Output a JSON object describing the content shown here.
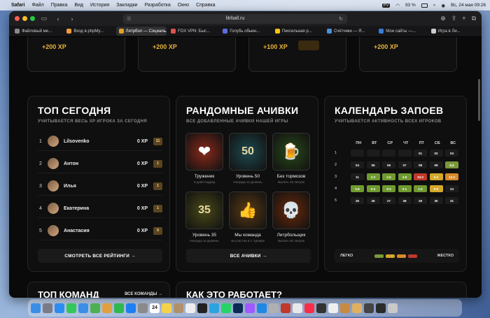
{
  "menubar": {
    "app": "Safari",
    "items": [
      "Файл",
      "Правка",
      "Вид",
      "История",
      "Закладки",
      "Разработка",
      "Окно",
      "Справка"
    ],
    "battery": "93 %",
    "datetime": "Вс, 24 мая  09:26",
    "kb_badge": "PV"
  },
  "browser": {
    "url": "litrball.ru",
    "tabs": [
      {
        "label": "Файловый ме...",
        "color": "#888888"
      },
      {
        "label": "Вход в phpMy...",
        "color": "#f29a3a"
      },
      {
        "label": "Литрбол — Социаль...",
        "color": "#e0a020",
        "active": true
      },
      {
        "label": "FOX VPN: Быс...",
        "color": "#d9534f"
      },
      {
        "label": "Голубь обыкн...",
        "color": "#5a6ee0"
      },
      {
        "label": "Пиксельная р...",
        "color": "#f1c40f"
      },
      {
        "label": "Счётчики — Я...",
        "color": "#4a90d9"
      },
      {
        "label": "Мои сайты —...",
        "color": "#3a7bd5"
      },
      {
        "label": "Игра в Ли...",
        "color": "#cccccc"
      }
    ]
  },
  "xp_strip": [
    "+200 XP",
    "+200 XP",
    "+100 XP",
    "+200 XP"
  ],
  "top_today": {
    "title": "ТОП СЕГОДНЯ",
    "subtitle": "УЧИТЫВАЕТСЯ ВЕСЬ XP ИГРОКА ЗА СЕГОДНЯ",
    "rows": [
      {
        "num": "1",
        "name": "Lilsovenko",
        "xp": "0 XP",
        "badge": "11"
      },
      {
        "num": "2",
        "name": "Антон",
        "xp": "0 XP",
        "badge": "1"
      },
      {
        "num": "3",
        "name": "Илья",
        "xp": "0 XP",
        "badge": "1"
      },
      {
        "num": "4",
        "name": "Екатерина",
        "xp": "0 XP",
        "badge": "1"
      },
      {
        "num": "5",
        "name": "Анастасия",
        "xp": "0 XP",
        "badge": "9"
      }
    ],
    "button": "СМОТРЕТЬ ВСЕ РЕЙТИНГИ →"
  },
  "achievements": {
    "title": "РАНДОМНЫЕ АЧИВКИ",
    "subtitle": "ВСЕ ДОБАВЛЕННЫЕ АЧИВКИ НАШЕЙ ИГРЫ",
    "items": [
      {
        "title": "Труженик",
        "desc": "5 дней подряд",
        "icon": "heart-icon",
        "glyph": "❤",
        "color": "#8a2a1a"
      },
      {
        "title": "Уровень 50",
        "desc": "Награда за уровень",
        "icon": "level-50-icon",
        "glyph": "50",
        "color": "#1e4a50"
      },
      {
        "title": "Без тормозов",
        "desc": "Выпить 25 литров",
        "icon": "beer-mug-icon",
        "glyph": "🍺",
        "color": "#2a4a1a"
      },
      {
        "title": "Уровень 35",
        "desc": "Награда за уровень",
        "icon": "level-35-icon",
        "glyph": "35",
        "color": "#4a4a18"
      },
      {
        "title": "Мы команда",
        "desc": "За участие в 1 турнире",
        "icon": "thumbs-up-icon",
        "glyph": "👍",
        "color": "#5a3a14"
      },
      {
        "title": "Литрбольщик",
        "desc": "Выпить 50 литров",
        "icon": "flaming-skull-icon",
        "glyph": "💀",
        "color": "#6a2a0a"
      }
    ],
    "button": "ВСЕ АЧИВКИ →"
  },
  "calendar": {
    "title": "КАЛЕНДАРЬ ЗАПОЕВ",
    "subtitle": "УЧИТЫВАЕТСЯ АКТИВНОСТЬ ВСЕХ ИГРОКОВ",
    "days": [
      "ПН",
      "ВТ",
      "СР",
      "ЧТ",
      "ПТ",
      "СБ",
      "ВС"
    ],
    "weeks": [
      {
        "label": "1",
        "cells": [
          {
            "v": "",
            "c": ""
          },
          {
            "v": "",
            "c": ""
          },
          {
            "v": "",
            "c": ""
          },
          {
            "v": "",
            "c": ""
          },
          {
            "v": "01",
            "c": ""
          },
          {
            "v": "02",
            "c": ""
          },
          {
            "v": "03",
            "c": ""
          }
        ]
      },
      {
        "label": "2",
        "cells": [
          {
            "v": "04",
            "c": ""
          },
          {
            "v": "05",
            "c": ""
          },
          {
            "v": "06",
            "c": ""
          },
          {
            "v": "07",
            "c": ""
          },
          {
            "v": "08",
            "c": ""
          },
          {
            "v": "09",
            "c": ""
          },
          {
            "v": "6.6",
            "c": "#7a9a3a"
          }
        ]
      },
      {
        "label": "3",
        "cells": [
          {
            "v": "11",
            "c": ""
          },
          {
            "v": "2.2",
            "c": "#6f9a30"
          },
          {
            "v": "2.5",
            "c": "#6f9a30"
          },
          {
            "v": "2.8",
            "c": "#6f9a30"
          },
          {
            "v": "33.0",
            "c": "#c0392b"
          },
          {
            "v": "5.4",
            "c": "#d4a82a"
          },
          {
            "v": "12.0",
            "c": "#d88a2a"
          }
        ]
      },
      {
        "label": "4",
        "cells": [
          {
            "v": "0.9",
            "c": "#6f9a30"
          },
          {
            "v": "0.3",
            "c": "#6f9a30"
          },
          {
            "v": "0.3",
            "c": "#6f9a30"
          },
          {
            "v": "0.1",
            "c": "#6f9a30"
          },
          {
            "v": "1.0",
            "c": "#6f9a30"
          },
          {
            "v": "0.9",
            "c": "#d4a82a"
          },
          {
            "v": "24",
            "c": ""
          }
        ]
      },
      {
        "label": "5",
        "cells": [
          {
            "v": "25",
            "c": ""
          },
          {
            "v": "26",
            "c": ""
          },
          {
            "v": "27",
            "c": ""
          },
          {
            "v": "28",
            "c": ""
          },
          {
            "v": "29",
            "c": ""
          },
          {
            "v": "30",
            "c": ""
          },
          {
            "v": "31",
            "c": ""
          }
        ]
      }
    ],
    "legend_easy": "ЛЕГКО",
    "legend_hard": "ЖЕСТКО",
    "legend_colors": [
      "#7a9a3a",
      "#d4a82a",
      "#d88a2a",
      "#c0392b"
    ]
  },
  "bottom": {
    "teams_title": "ТОП КОМАНД",
    "teams_link": "ВСЕ КОМАНДЫ →",
    "how_title": "КАК ЭТО РАБОТАЕТ?"
  },
  "dock": {
    "calendar_day": "24",
    "apps": [
      {
        "name": "finder-icon",
        "color": "#3a8ee6"
      },
      {
        "name": "launchpad-icon",
        "color": "#7a7a88"
      },
      {
        "name": "safari-icon",
        "color": "#2d8cf0"
      },
      {
        "name": "messages-icon",
        "color": "#34c759"
      },
      {
        "name": "mail-icon",
        "color": "#3a8ee6"
      },
      {
        "name": "maps-icon",
        "color": "#4caf50"
      },
      {
        "name": "photos-icon",
        "color": "#e0a040"
      },
      {
        "name": "facetime-icon",
        "color": "#2fb84f"
      },
      {
        "name": "appstore-icon",
        "color": "#1e7ff0"
      },
      {
        "name": "settings-icon",
        "color": "#8a8a8a"
      },
      {
        "name": "calendar-icon",
        "color": "#ffffff"
      },
      {
        "name": "notes-icon",
        "color": "#f5d24a"
      },
      {
        "name": "contacts-icon",
        "color": "#b0926a"
      },
      {
        "name": "reminders-icon",
        "color": "#eeeeee"
      },
      {
        "name": "terminal-icon",
        "color": "#222222"
      },
      {
        "name": "telegram-icon",
        "color": "#2aa3e0"
      },
      {
        "name": "whatsapp-icon",
        "color": "#25d366"
      },
      {
        "name": "photoshop-icon",
        "color": "#0b2a55"
      },
      {
        "name": "figma-icon",
        "color": "#a259ff"
      },
      {
        "name": "vscode-icon",
        "color": "#1e88e5"
      },
      {
        "name": "remote-icon",
        "color": "#b0b0b0"
      },
      {
        "name": "filezilla-icon",
        "color": "#c0392b"
      },
      {
        "name": "chrome-icon",
        "color": "#e8e8e8"
      },
      {
        "name": "music-icon",
        "color": "#fa2d48"
      },
      {
        "name": "activity-icon",
        "color": "#333333"
      },
      {
        "name": "openai-icon",
        "color": "#eeeeee"
      },
      {
        "name": "bird-icon",
        "color": "#c88a40"
      },
      {
        "name": "dog-icon",
        "color": "#e0b060"
      },
      {
        "name": "cube-icon",
        "color": "#444444"
      },
      {
        "name": "litrball-icon",
        "color": "#2a2a2a"
      },
      {
        "name": "trash-icon",
        "color": "#c8c8c8"
      }
    ]
  }
}
